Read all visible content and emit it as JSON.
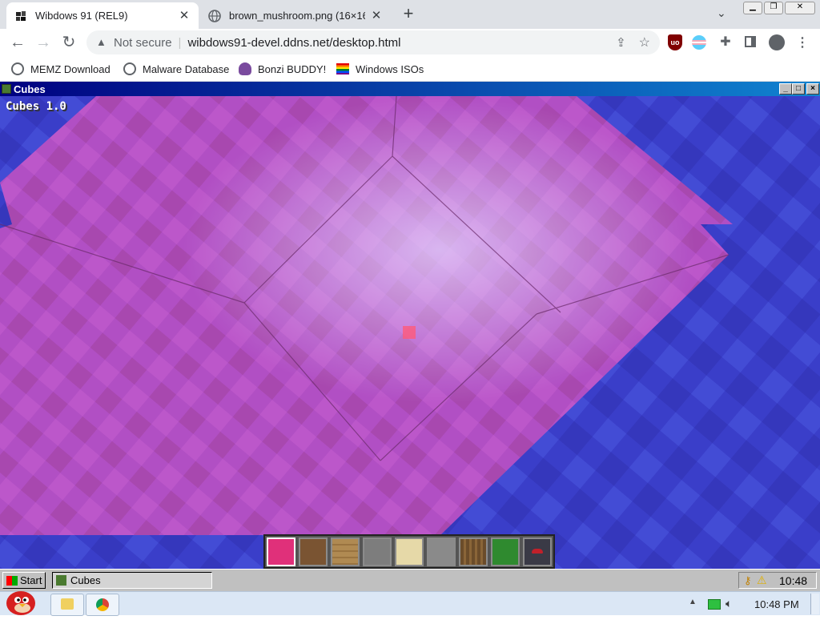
{
  "browser": {
    "tabs": [
      {
        "title": "Wibdows 91 (REL9)",
        "active": true
      },
      {
        "title": "brown_mushroom.png (16×16)",
        "active": false
      }
    ],
    "new_tab_symbol": "+",
    "security_label": "Not secure",
    "url": "wibdows91-devel.ddns.net/desktop.html",
    "bookmarks": [
      {
        "label": "MEMZ Download",
        "icon": "globe-icon"
      },
      {
        "label": "Malware Database",
        "icon": "globe-icon"
      },
      {
        "label": "Bonzi BUDDY!",
        "icon": "bonzi-icon"
      },
      {
        "label": "Windows ISOs",
        "icon": "rainbow-flag-icon"
      }
    ],
    "extension_badge": "uo"
  },
  "window": {
    "title": "Cubes",
    "game_title": "Cubes 1.0",
    "minimize": "_",
    "maximize": "□",
    "close": "×"
  },
  "hotbar": {
    "selected_index": 0,
    "blocks": [
      "pink-wool",
      "dirt",
      "oak-planks",
      "gravel",
      "sand",
      "stone",
      "oak-log",
      "leaves",
      "mushroom"
    ]
  },
  "taskbar95": {
    "start_label": "Start",
    "task_label": "Cubes",
    "clock": "10:48"
  },
  "win_taskbar": {
    "clock": "10:48 PM"
  },
  "colors": {
    "sky": "#3b3fd0",
    "wool": "#b34fc8",
    "title_gradient_start": "#000080",
    "title_gradient_end": "#1084d0"
  }
}
